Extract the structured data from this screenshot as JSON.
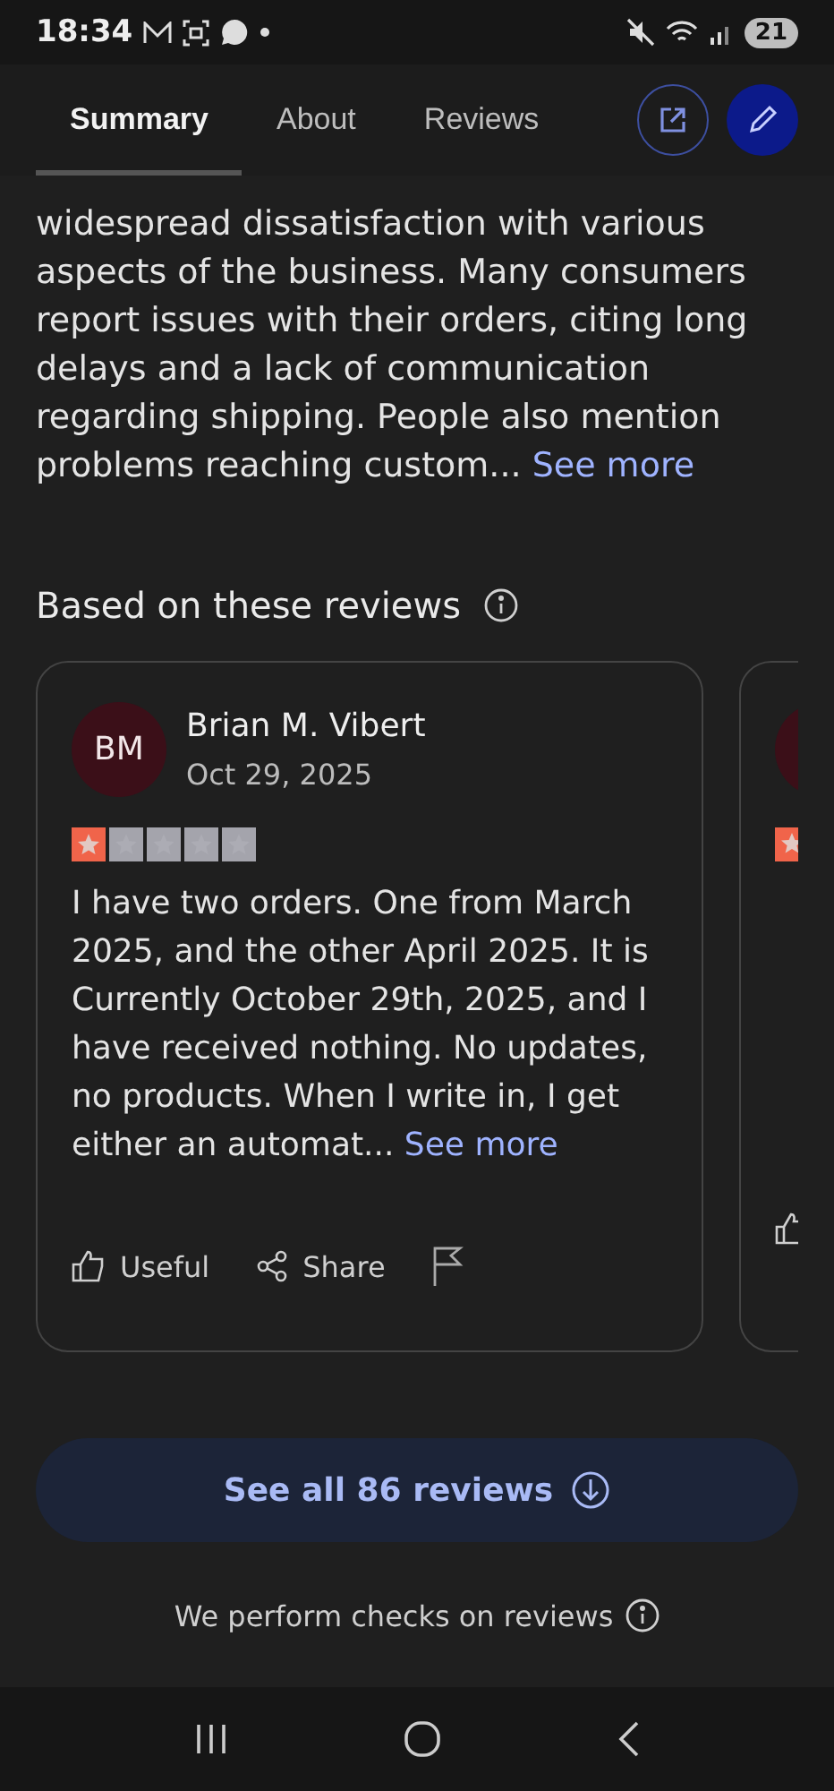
{
  "status_bar": {
    "time": "18:34",
    "battery": "21"
  },
  "tabs": [
    {
      "label": "Summary",
      "selected": true
    },
    {
      "label": "About",
      "selected": false
    },
    {
      "label": "Reviews",
      "selected": false
    }
  ],
  "summary": {
    "text": "widespread dissatisfaction with various aspects of the business. Many consumers report issues with their orders, citing long delays and a lack of communication regarding shipping. People also mention problems reaching custom...",
    "link": "See more"
  },
  "section_title": "Based on these reviews",
  "reviews": [
    {
      "kind": "full",
      "initials": "BM",
      "name": "Brian M. Vibert",
      "date": "Oct 29, 2025",
      "stars": 1,
      "text": "I have two orders. One from March 2025, and the other April 2025. It is Currently October 29th, 2025, and I have received nothing. No updates, no products. When I write in, I get either an automat...",
      "link": "See more",
      "actions": [
        "Useful",
        "Share"
      ]
    },
    {
      "kind": "peek"
    }
  ],
  "see_all_button": "See all 86 reviews",
  "footer_note": "We perform checks on reviews"
}
